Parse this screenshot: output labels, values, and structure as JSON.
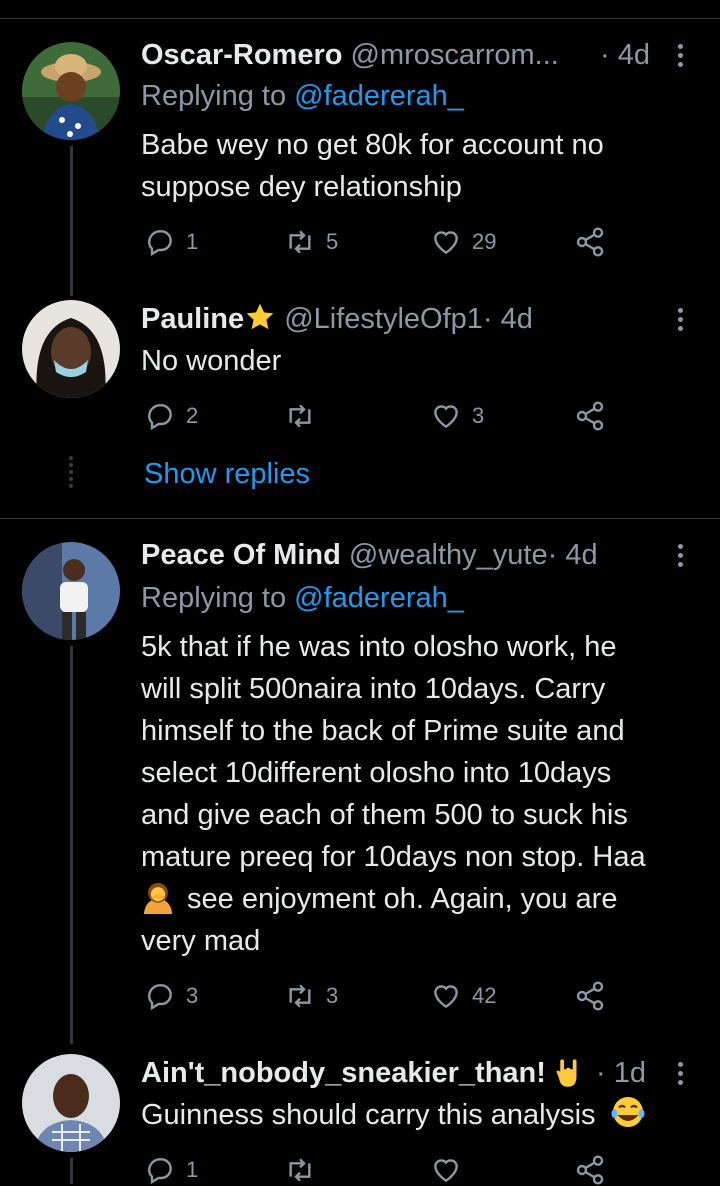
{
  "tweets": [
    {
      "name": "Oscar-Romero",
      "handle": "@mroscarrom...",
      "time": "· 4d",
      "replying_prefix": "Replying to ",
      "replying_to": "@fadererah_",
      "text": [
        "Babe wey no get 80k for account no",
        "suppose dey relationship"
      ],
      "replies": "1",
      "retweets": "5",
      "likes": "29"
    },
    {
      "name": "Pauline",
      "handle": "@LifestyleOfp1",
      "time": "· 4d",
      "text": [
        "No wonder"
      ],
      "replies": "2",
      "retweets": "",
      "likes": "3"
    },
    {
      "name": "Peace Of Mind",
      "handle": "@wealthy_yute",
      "time": "· 4d",
      "replying_prefix": "Replying to ",
      "replying_to": "@fadererah_",
      "text": [
        "5k that if he was into olosho work, he",
        "will split 500naira into 10days. Carry",
        "himself to the back of Prime suite and",
        "select 10different olosho into 10days",
        "and give each of them 500 to suck his",
        "mature preeq for 10days non stop. Haa",
        "see enjoyment oh. Again, you are",
        "very mad"
      ],
      "replies": "3",
      "retweets": "3",
      "likes": "42"
    },
    {
      "name": "Ain't_nobody_sneakier_than!",
      "time": "· 1d",
      "text": [
        "Guinness should carry this analysis"
      ],
      "replies": "1",
      "retweets": "",
      "likes": ""
    }
  ],
  "show_replies": "Show replies",
  "colors": {
    "background": "#000000",
    "link": "#1d9bf0",
    "muted": "#8b98a5",
    "text": "#e7e9ea",
    "star": "#ffcc33"
  },
  "icons": [
    "reply-icon",
    "retweet-icon",
    "like-icon",
    "share-icon",
    "more-icon",
    "star-emoji",
    "facepalm-woman-emoji",
    "rock-hand-emoji",
    "laughing-tears-emoji"
  ]
}
